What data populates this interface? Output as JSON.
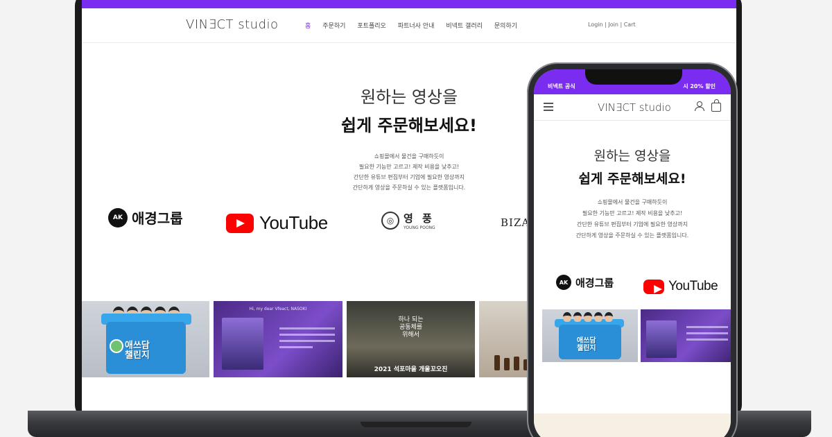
{
  "laptop": {
    "logo": "VIN∃CT studio",
    "nav": [
      "홈",
      "주문하기",
      "포트폴리오",
      "파트너사 안내",
      "비넥트 갤러리",
      "문의하기"
    ],
    "util": "Login  |  Join  |  Cart",
    "hero_line1": "원하는 영상을",
    "hero_line2": "쉽게 주문해보세요!",
    "desc": [
      "쇼핑몰에서 물건을 구매하듯이",
      "필요한 기능만 고르고! 제작 비용을 낮추고!",
      "간단한 유튜브 편집부터 기업에 필요한 영상까지",
      "간단하게 영상을 주문하실 수 있는 플랫폼입니다."
    ],
    "brands": {
      "aekyung": "애경그룹",
      "aekyung_icon": "AK",
      "youtube": "YouTube",
      "youngpoong_ko": "영 풍",
      "youngpoong_en": "YOUNG POONG",
      "bizar": "BIZAR"
    },
    "thumbs": {
      "t1_text": [
        "애쓰담",
        "챌린지"
      ],
      "t2_title": "Hi, my dear Vfeact, NASOKI",
      "t3_text": [
        "하나 되는",
        "공동체를",
        "위해서"
      ],
      "t3_bottom": "2021 석포마을 개울꼬오진"
    }
  },
  "phone": {
    "topbar_left": "비넥트 공식",
    "topbar_right": "시 20% 할인",
    "logo": "VIN∃CT studio",
    "hero_line1": "원하는 영상을",
    "hero_line2": "쉽게 주문해보세요!",
    "desc": [
      "쇼핑몰에서 물건을 구매하듯이",
      "필요한 기능만 고르고! 제작 비용을 낮추고!",
      "간단한 유튜브 편집부터 기업에 필요한 영상까지",
      "간단하게 영상을 주문하실 수 있는 플랫폼입니다."
    ],
    "brands": {
      "aekyung": "애경그룹",
      "aekyung_icon": "AK",
      "youtube": "YouTube"
    },
    "thumb_text": [
      "애쓰담",
      "챌린지"
    ]
  },
  "colors": {
    "accent": "#7a2cf0",
    "youtube_red": "#ff0000"
  }
}
